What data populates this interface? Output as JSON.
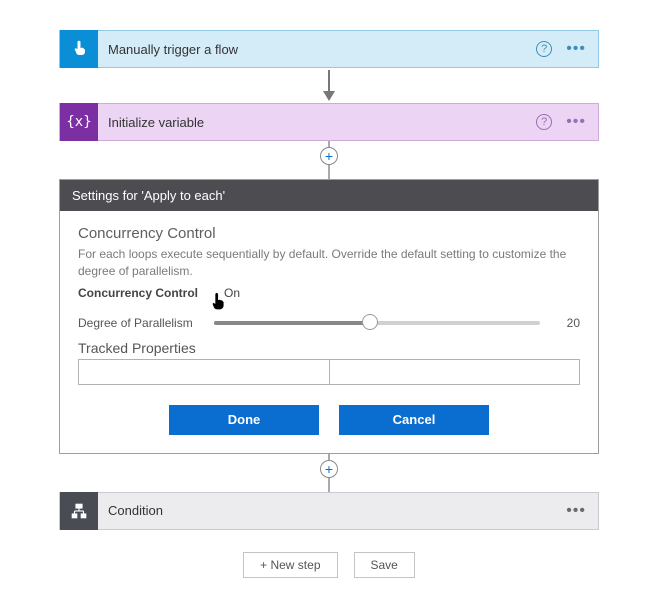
{
  "cards": {
    "trigger": {
      "title": "Manually trigger a flow"
    },
    "variable": {
      "title": "Initialize variable"
    },
    "condition": {
      "title": "Condition"
    }
  },
  "settings": {
    "header": "Settings for 'Apply to each'",
    "section_title": "Concurrency Control",
    "section_desc": "For each loops execute sequentially by default. Override the default setting to customize the degree of parallelism.",
    "toggle_label": "Concurrency Control",
    "toggle_state": "On",
    "slider_label": "Degree of Parallelism",
    "slider_value": "20",
    "tracked_title": "Tracked Properties",
    "done": "Done",
    "cancel": "Cancel"
  },
  "footer": {
    "new_step": "+ New step",
    "save": "Save"
  }
}
